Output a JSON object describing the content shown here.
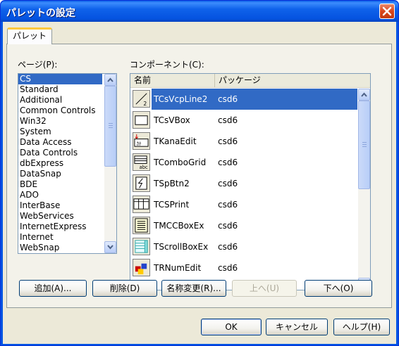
{
  "window": {
    "title": "パレットの設定"
  },
  "tabs": [
    {
      "label": "パレット"
    }
  ],
  "pages": {
    "label": "ページ(P):",
    "items": [
      "CS",
      "Standard",
      "Additional",
      "Common Controls",
      "Win32",
      "System",
      "Data Access",
      "Data Controls",
      "dbExpress",
      "DataSnap",
      "BDE",
      "ADO",
      "InterBase",
      "WebServices",
      "InternetExpress",
      "Internet",
      "WebSnap"
    ],
    "selected": "CS"
  },
  "components": {
    "label": "コンポーネント(C):",
    "columns": [
      "名前",
      "パッケージ"
    ],
    "rows": [
      {
        "name": "TCsVcpLine2",
        "package": "csd6",
        "icon": "line-icon",
        "selected": true
      },
      {
        "name": "TCsVBox",
        "package": "csd6",
        "icon": "box-icon"
      },
      {
        "name": "TKanaEdit",
        "package": "csd6",
        "icon": "kana-icon"
      },
      {
        "name": "TComboGrid",
        "package": "csd6",
        "icon": "combo-grid-icon"
      },
      {
        "name": "TSpBtn2",
        "package": "csd6",
        "icon": "speed-button-icon"
      },
      {
        "name": "TCSPrint",
        "package": "csd6",
        "icon": "print-grid-icon"
      },
      {
        "name": "TMCCBoxEx",
        "package": "csd6",
        "icon": "memo-icon"
      },
      {
        "name": "TScrollBoxEx",
        "package": "csd6",
        "icon": "scroll-box-icon"
      },
      {
        "name": "TRNumEdit",
        "package": "csd6",
        "icon": "num-edit-icon"
      }
    ]
  },
  "buttons": {
    "add": "追加(A)...",
    "delete": "削除(D)",
    "rename": "名称変更(R)...",
    "up": "上へ(U)",
    "down": "下へ(O)",
    "ok": "OK",
    "cancel": "キャンセル",
    "help": "ヘルプ(H)"
  },
  "colors": {
    "selection": "#316ac5",
    "titlebar": "#0054e3",
    "face": "#ece9d8"
  }
}
